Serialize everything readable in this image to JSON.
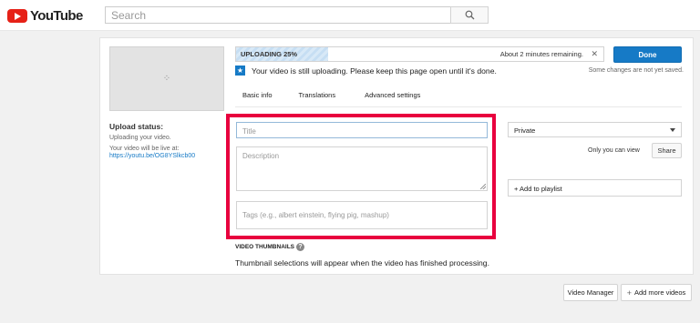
{
  "header": {
    "logo_text": "YouTube",
    "search_placeholder": "Search"
  },
  "upload": {
    "progress_label": "UPLOADING 25%",
    "progress_value": 0.25,
    "remaining": "About 2 minutes remaining.",
    "notice": "Your video is still uploading. Please keep this page open until it's done.",
    "done_label": "Done",
    "unsaved_note": "Some changes are not yet saved."
  },
  "tabs": [
    "Basic info",
    "Translations",
    "Advanced settings"
  ],
  "status": {
    "title": "Upload status:",
    "line": "Uploading your video.",
    "live_label": "Your video will be live at:",
    "url": "https://youtu.be/OG8YSlkcb00"
  },
  "form": {
    "title_placeholder": "Title",
    "description_placeholder": "Description",
    "tags_placeholder": "Tags (e.g., albert einstein, flying pig, mashup)"
  },
  "privacy": {
    "selected": "Private",
    "visibility_note": "Only you can view",
    "share_label": "Share",
    "playlist_label": "+ Add to playlist"
  },
  "thumbnails": {
    "heading": "VIDEO THUMBNAILS",
    "text": "Thumbnail selections will appear when the video has finished processing."
  },
  "footer": {
    "video_manager": "Video Manager",
    "add_more_videos": "Add more videos"
  },
  "colors": {
    "accent_blue": "#167ac6",
    "highlight_red": "#e8003e",
    "youtube_red": "#e62117"
  }
}
